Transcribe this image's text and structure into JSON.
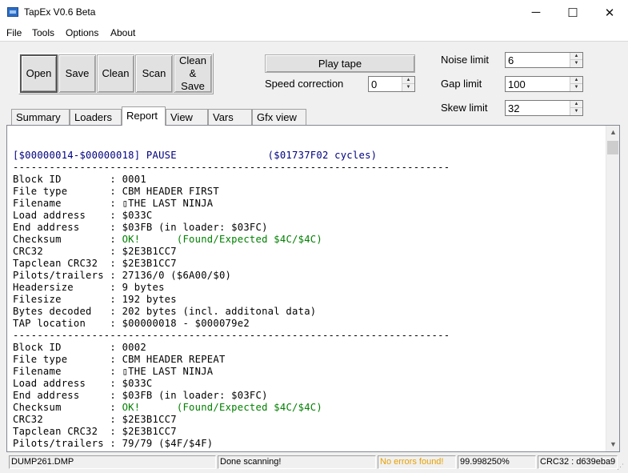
{
  "window": {
    "title": "TapEx V0.6 Beta",
    "minimize_glyph": "─",
    "maximize_glyph": "☐",
    "close_glyph": "✕"
  },
  "menu": [
    "File",
    "Tools",
    "Options",
    "About"
  ],
  "toolbar": {
    "open_label": "Open",
    "save_label": "Save",
    "clean_label": "Clean",
    "scan_label": "Scan",
    "clean_save_line1": "Clean",
    "clean_save_line2": "&",
    "clean_save_line3": "Save",
    "play_tape_label": "Play tape"
  },
  "speed_correction": {
    "label": "Speed correction",
    "value": "0"
  },
  "limits": {
    "noise_label": "Noise limit",
    "noise_value": "6",
    "gap_label": "Gap limit",
    "gap_value": "100",
    "skew_label": "Skew limit",
    "skew_value": "32"
  },
  "tabs": [
    "Summary",
    "Loaders",
    "Report",
    "View",
    "Vars",
    "Gfx view"
  ],
  "active_tab": "Report",
  "report": {
    "lines": [
      {
        "text": "",
        "color": ""
      },
      {
        "text": "",
        "color": ""
      },
      {
        "text": "[$00000014-$00000018] PAUSE               ($01737F02 cycles)",
        "color": "blue"
      },
      {
        "text": "------------------------------------------------------------------------",
        "color": ""
      },
      {
        "text": "Block ID        : 0001",
        "color": ""
      },
      {
        "text": "File type       : CBM HEADER FIRST",
        "color": ""
      },
      {
        "text": "Filename        : ▯THE LAST NINJA",
        "color": ""
      },
      {
        "text": "Load address    : $033C",
        "color": ""
      },
      {
        "text": "End address     : $03FB (in loader: $03FC)",
        "color": ""
      },
      {
        "text_a": "Checksum        : ",
        "text_b": "OK!      (Found/Expected $4C/$4C)",
        "color": "green-tail"
      },
      {
        "text": "CRC32           : $2E3B1CC7",
        "color": ""
      },
      {
        "text": "Tapclean CRC32  : $2E3B1CC7",
        "color": ""
      },
      {
        "text": "Pilots/trailers : 27136/0 ($6A00/$0)",
        "color": ""
      },
      {
        "text": "Headersize      : 9 bytes",
        "color": ""
      },
      {
        "text": "Filesize        : 192 bytes",
        "color": ""
      },
      {
        "text": "Bytes decoded   : 202 bytes (incl. additonal data)",
        "color": ""
      },
      {
        "text": "TAP location    : $00000018 - $000079e2",
        "color": ""
      },
      {
        "text": "------------------------------------------------------------------------",
        "color": ""
      },
      {
        "text": "Block ID        : 0002",
        "color": ""
      },
      {
        "text": "File type       : CBM HEADER REPEAT",
        "color": ""
      },
      {
        "text": "Filename        : ▯THE LAST NINJA",
        "color": ""
      },
      {
        "text": "Load address    : $033C",
        "color": ""
      },
      {
        "text": "End address     : $03FB (in loader: $03FC)",
        "color": ""
      },
      {
        "text_a": "Checksum        : ",
        "text_b": "OK!      (Found/Expected $4C/$4C)",
        "color": "green-tail"
      },
      {
        "text": "CRC32           : $2E3B1CC7",
        "color": ""
      },
      {
        "text": "Tapclean CRC32  : $2E3B1CC7",
        "color": ""
      },
      {
        "text": "Pilots/trailers : 79/79 ($4F/$4F)",
        "color": ""
      }
    ]
  },
  "scrollbar": {
    "up_glyph": "▲",
    "down_glyph": "▼"
  },
  "status": {
    "file": "DUMP261.DMP",
    "message": "Done scanning!",
    "errors": "No errors found!",
    "percent": "99.998250%",
    "crc": "CRC32 : d639eba9",
    "warn_color": "#e8a000"
  }
}
